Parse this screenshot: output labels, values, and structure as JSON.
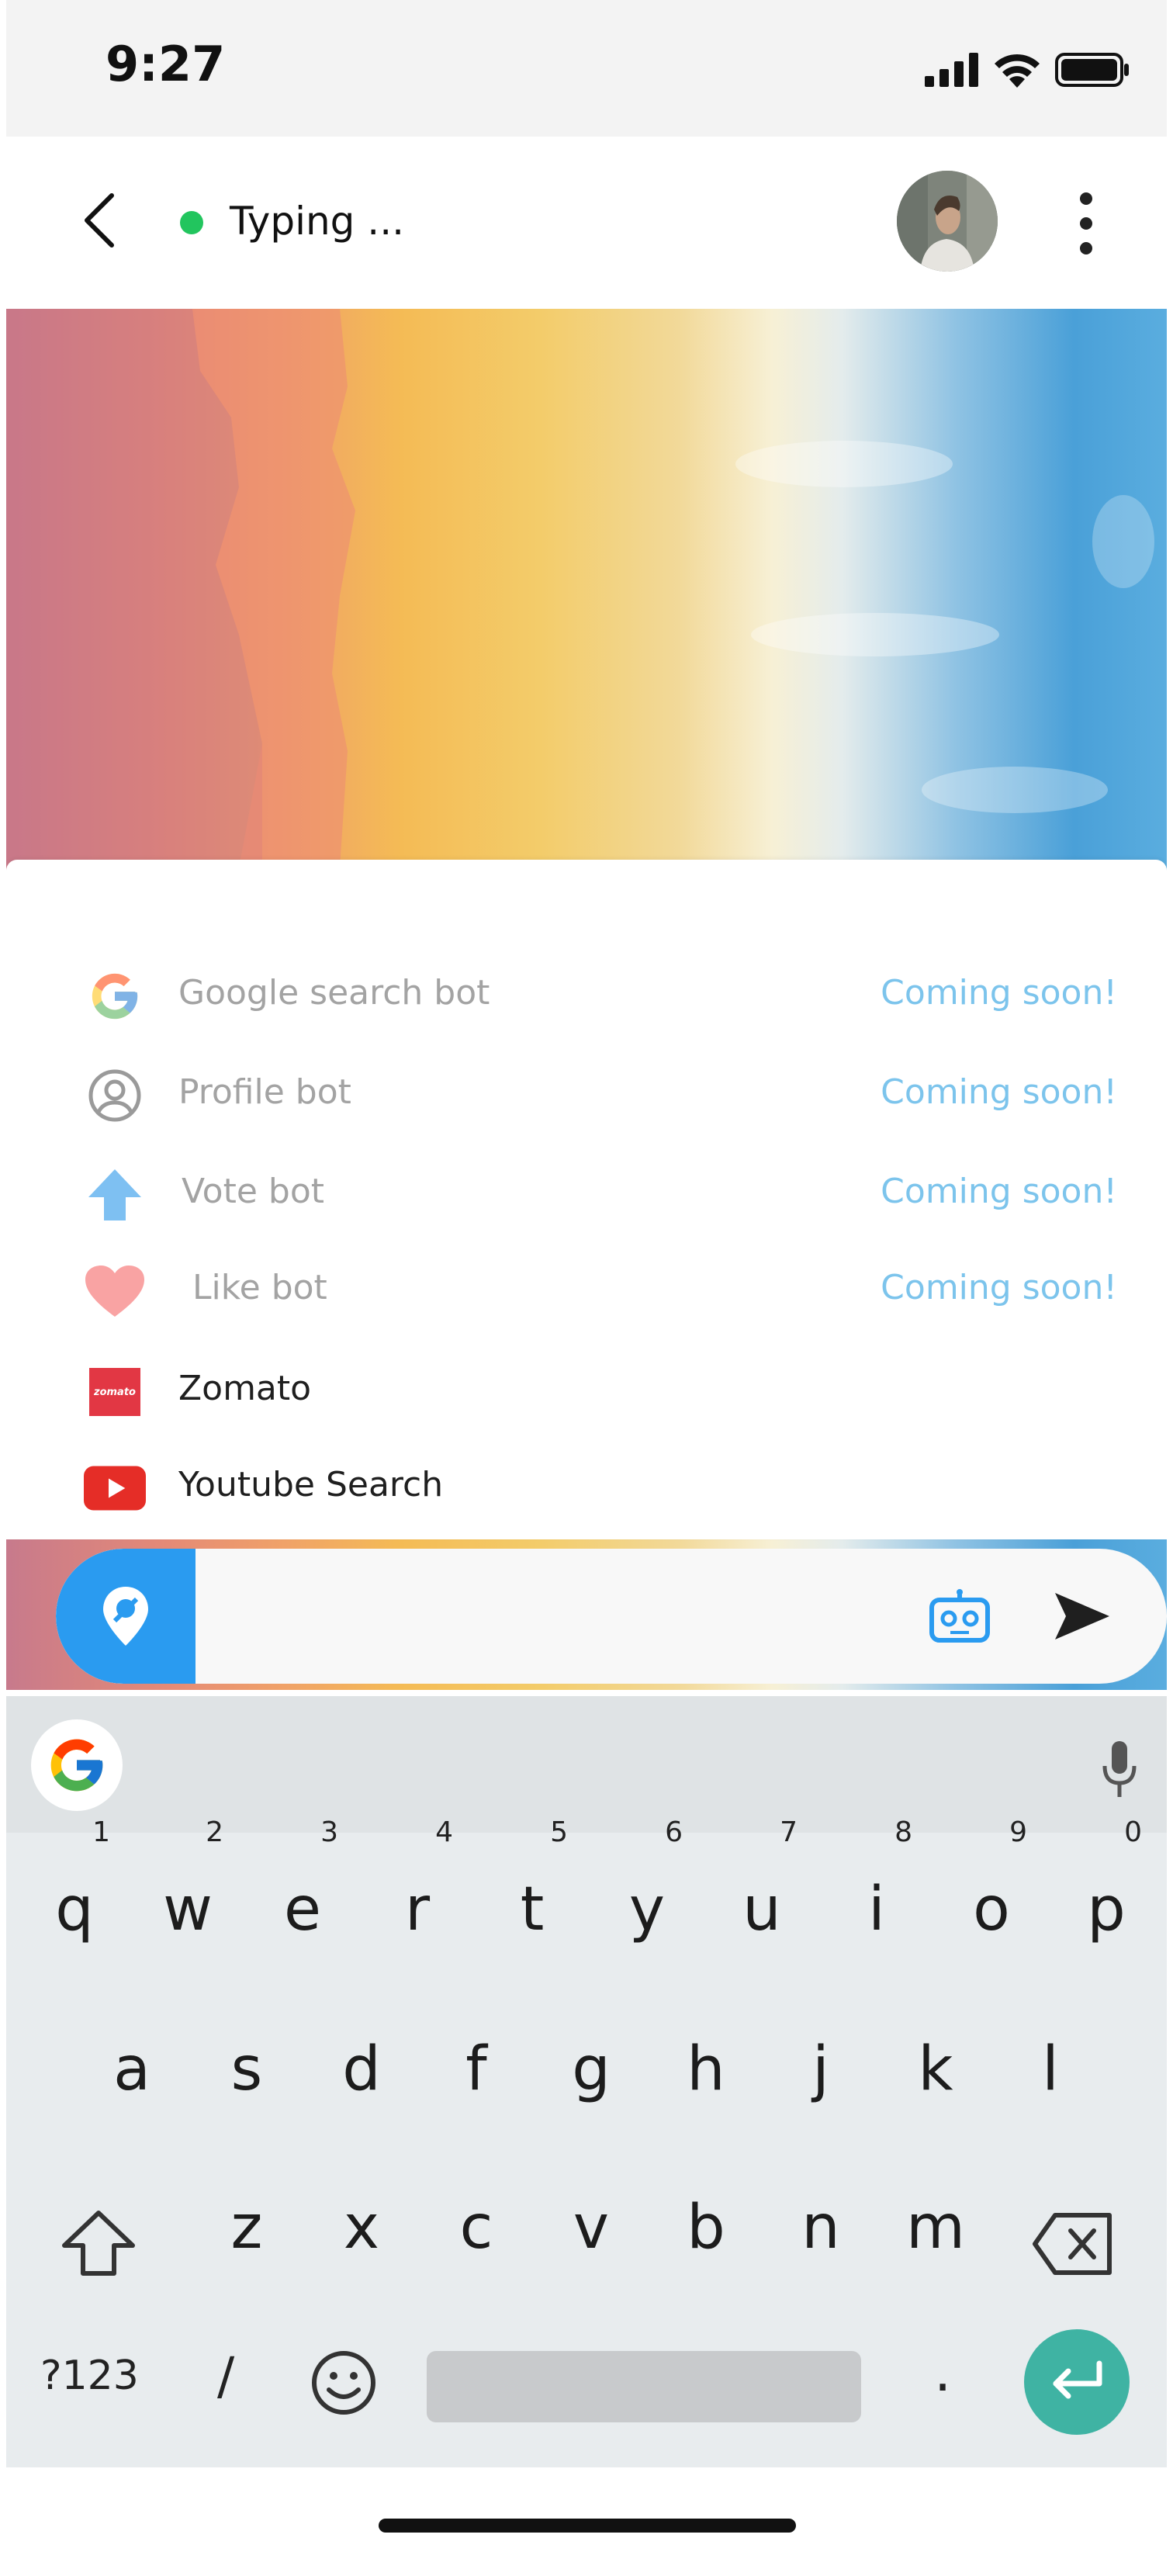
{
  "status_bar": {
    "time": "9:27"
  },
  "header": {
    "status_text": "Typing ..."
  },
  "bots": [
    {
      "name": "Google search bot",
      "status": "Coming soon!",
      "icon": "google-g-icon",
      "active": false
    },
    {
      "name": "Profile bot",
      "status": "Coming soon!",
      "icon": "profile-icon",
      "active": false
    },
    {
      "name": "Vote bot",
      "status": "Coming soon!",
      "icon": "upvote-arrow-icon",
      "active": false
    },
    {
      "name": "Like bot",
      "status": "Coming soon!",
      "icon": "heart-icon",
      "active": false
    },
    {
      "name": "Zomato",
      "status": "",
      "icon": "zomato-logo-icon",
      "icon_text": "zomato",
      "active": true
    },
    {
      "name": "Youtube Search",
      "status": "",
      "icon": "youtube-icon",
      "active": true
    }
  ],
  "input": {
    "placeholder": ""
  },
  "keyboard": {
    "row1": [
      "q",
      "w",
      "e",
      "r",
      "t",
      "y",
      "u",
      "i",
      "o",
      "p"
    ],
    "row1_numbers": [
      "1",
      "2",
      "3",
      "4",
      "5",
      "6",
      "7",
      "8",
      "9",
      "0"
    ],
    "row2": [
      "a",
      "s",
      "d",
      "f",
      "g",
      "h",
      "j",
      "k",
      "l"
    ],
    "row3": [
      "z",
      "x",
      "c",
      "v",
      "b",
      "n",
      "m"
    ],
    "symbols_label": "?123",
    "slash": "/",
    "period": "."
  },
  "colors": {
    "online": "#22c55e",
    "accent_blue": "#2a9bf0",
    "coming_soon": "#7cc4ec",
    "enter_key": "#3fb3a3",
    "zomato_red": "#e23744",
    "youtube_red": "#e52d27"
  }
}
